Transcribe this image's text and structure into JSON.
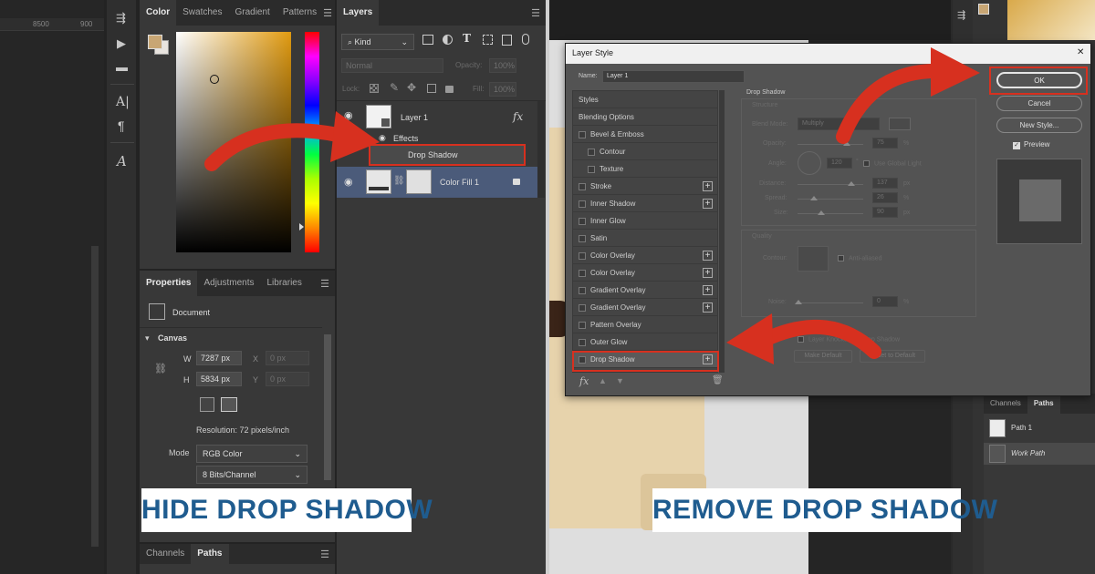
{
  "ruler": {
    "ticks": [
      "8500",
      "900"
    ]
  },
  "color_panel": {
    "tabs": [
      "Color",
      "Swatches",
      "Gradient",
      "Patterns"
    ]
  },
  "layers_panel": {
    "tab": "Layers",
    "filter": "Kind",
    "blend": "Normal",
    "opacity_label": "Opacity:",
    "opacity_value": "100%",
    "lock_label": "Lock:",
    "fill_label": "Fill:",
    "fill_value": "100%",
    "layer1": "Layer 1",
    "fx": "fx",
    "effects": "Effects",
    "drop_shadow": "Drop Shadow",
    "colorfill": "Color Fill 1"
  },
  "properties_panel": {
    "tabs": [
      "Properties",
      "Adjustments",
      "Libraries"
    ],
    "document": "Document",
    "canvas": "Canvas",
    "w_label": "W",
    "w_value": "7287 px",
    "x_label": "X",
    "x_value": "0 px",
    "h_label": "H",
    "h_value": "5834 px",
    "y_label": "Y",
    "y_value": "0 px",
    "resolution": "Resolution: 72 pixels/inch",
    "mode_label": "Mode",
    "mode_value": "RGB Color",
    "bits_value": "8 Bits/Channel"
  },
  "bottom_left_tabs": [
    "Channels",
    "Paths"
  ],
  "banner_left": "HIDE DROP SHADOW",
  "banner_right": "REMOVE DROP SHADOW",
  "layer_style": {
    "title": "Layer Style",
    "close": "✕",
    "name_label": "Name:",
    "name_value": "Layer 1",
    "styles_header": "Styles",
    "blending": "Blending Options",
    "items": [
      {
        "label": "Bevel & Emboss",
        "plus": false,
        "indent": false
      },
      {
        "label": "Contour",
        "plus": false,
        "indent": true
      },
      {
        "label": "Texture",
        "plus": false,
        "indent": true
      },
      {
        "label": "Stroke",
        "plus": true,
        "indent": false
      },
      {
        "label": "Inner Shadow",
        "plus": true,
        "indent": false
      },
      {
        "label": "Inner Glow",
        "plus": false,
        "indent": false
      },
      {
        "label": "Satin",
        "plus": false,
        "indent": false
      },
      {
        "label": "Color Overlay",
        "plus": true,
        "indent": false
      },
      {
        "label": "Color Overlay",
        "plus": true,
        "indent": false
      },
      {
        "label": "Gradient Overlay",
        "plus": true,
        "indent": false
      },
      {
        "label": "Gradient Overlay",
        "plus": true,
        "indent": false
      },
      {
        "label": "Pattern Overlay",
        "plus": false,
        "indent": false
      },
      {
        "label": "Outer Glow",
        "plus": false,
        "indent": false
      },
      {
        "label": "Drop Shadow",
        "plus": true,
        "indent": false
      }
    ],
    "footer_fx": "fx",
    "ds_title": "Drop Shadow",
    "structure": "Structure",
    "blend_mode_label": "Blend Mode:",
    "blend_mode_value": "Multiply",
    "opacity_label": "Opacity:",
    "opacity_value": "75",
    "pct": "%",
    "angle_label": "Angle:",
    "angle_value": "120",
    "deg": "°",
    "global_light": "Use Global Light",
    "distance_label": "Distance:",
    "distance_value": "137",
    "px": "px",
    "spread_label": "Spread:",
    "spread_value": "26",
    "size_label": "Size:",
    "size_value": "90",
    "quality": "Quality",
    "contour_label": "Contour:",
    "antialiased": "Anti-aliased",
    "noise_label": "Noise:",
    "noise_value": "0",
    "knocks_out": "Layer Knocks Out Drop Shadow",
    "make_default": "Make Default",
    "reset_default": "Reset to Default",
    "ok": "OK",
    "cancel": "Cancel",
    "new_style": "New Style...",
    "preview": "Preview"
  },
  "right_paths": {
    "tabs": [
      "Channels",
      "Paths"
    ],
    "path1": "Path 1",
    "work_path": "Work Path"
  },
  "colors": {
    "accent_red": "#d7301f",
    "banner_blue": "#1f5c8f",
    "selected_layer": "#4b5b7a"
  }
}
